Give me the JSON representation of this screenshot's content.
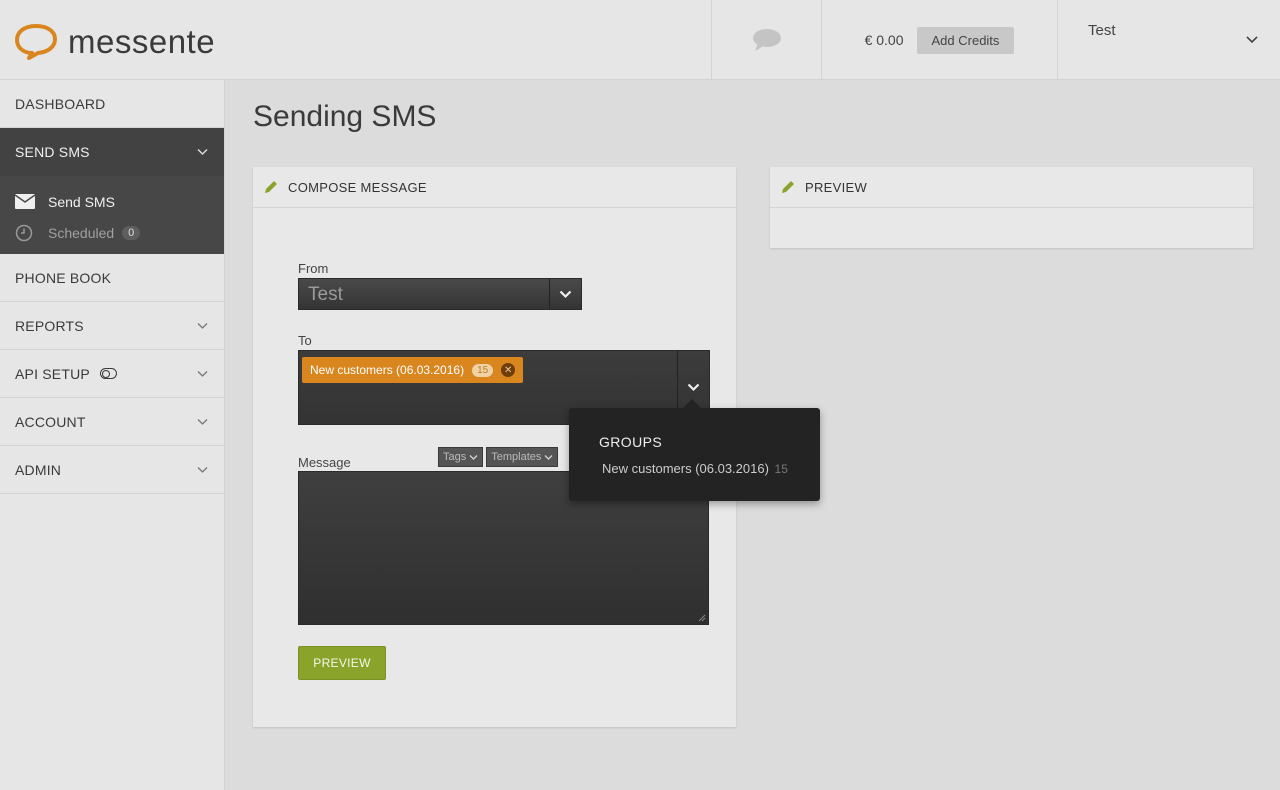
{
  "brand": {
    "logo_text": "messente",
    "accent": "#d9861f"
  },
  "header": {
    "chat_icon": "speech-bubble-icon",
    "balance": "€ 0.00",
    "add_credits_label": "Add Credits",
    "user_name": "Test"
  },
  "sidebar": {
    "items": [
      {
        "label": "DASHBOARD"
      },
      {
        "label": "SEND SMS",
        "active": true
      },
      {
        "label": "PHONE BOOK"
      },
      {
        "label": "REPORTS"
      },
      {
        "label": "API SETUP"
      },
      {
        "label": "ACCOUNT"
      },
      {
        "label": "ADMIN"
      }
    ],
    "sub_items": [
      {
        "label": "Send SMS",
        "icon": "envelope-icon",
        "current": true
      },
      {
        "label": "Scheduled",
        "icon": "clock-icon",
        "badge": "0"
      }
    ]
  },
  "main": {
    "title": "Sending SMS",
    "compose": {
      "heading": "COMPOSE MESSAGE",
      "from_label": "From",
      "from_value": "Test",
      "to_label": "To",
      "recipient_chip": {
        "label": "New customers (06.03.2016)",
        "count": "15"
      },
      "message_label": "Message",
      "tags_label": "Tags",
      "templates_label": "Templates",
      "preview_button": "PREVIEW"
    },
    "preview": {
      "heading": "PREVIEW"
    },
    "groups_popup": {
      "title": "GROUPS",
      "item_label": "New customers (06.03.2016)",
      "item_count": "15"
    }
  },
  "colors": {
    "sidebar_active": "#424242",
    "preview_button": "#8aa32b",
    "pencil": "#8aa32b"
  }
}
